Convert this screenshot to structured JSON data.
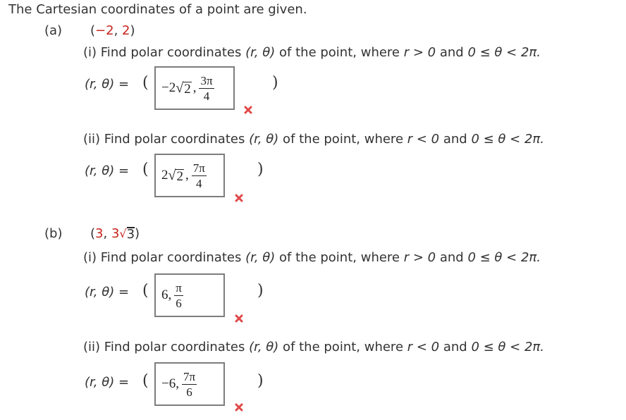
{
  "title": "The Cartesian coordinates of a point are given.",
  "parts": [
    {
      "label": "(a)",
      "point": {
        "open": "(",
        "x": "−2",
        "sep": ", ",
        "y": "2",
        "close": ")"
      },
      "subparts": [
        {
          "prompt_prefix": "(i) Find polar coordinates ",
          "prompt_vars": "(r, θ)",
          "prompt_mid": " of the point, where ",
          "condition_r": "r > 0",
          "prompt_and": " and ",
          "condition_theta": "0 ≤ θ < 2π.",
          "eq_label": "(r, θ) =",
          "open_paren": "(",
          "close_paren": ")",
          "answer": {
            "r_sign": "−",
            "r_coef": "2",
            "r_radicand": "2",
            "sep": ",",
            "theta_num": "3π",
            "theta_den": "4"
          },
          "status": "incorrect",
          "status_icon": "x-mark-icon"
        },
        {
          "prompt_prefix": "(ii) Find polar coordinates ",
          "prompt_vars": "(r, θ)",
          "prompt_mid": " of the point, where ",
          "condition_r": "r < 0",
          "prompt_and": " and ",
          "condition_theta": "0 ≤ θ < 2π.",
          "eq_label": "(r, θ) =",
          "open_paren": "(",
          "close_paren": ")",
          "answer": {
            "r_sign": "",
            "r_coef": "2",
            "r_radicand": "2",
            "sep": ",",
            "theta_num": "7π",
            "theta_den": "4"
          },
          "status": "incorrect",
          "status_icon": "x-mark-icon"
        }
      ]
    },
    {
      "label": "(b)",
      "point": {
        "open": "(",
        "x": "3",
        "sep": ", ",
        "y_coef": "3",
        "y_radicand": "3",
        "close": ")"
      },
      "subparts": [
        {
          "prompt_prefix": "(i) Find polar coordinates ",
          "prompt_vars": "(r, θ)",
          "prompt_mid": " of the point, where ",
          "condition_r": "r > 0",
          "prompt_and": " and ",
          "condition_theta": "0 ≤ θ < 2π.",
          "eq_label": "(r, θ) =",
          "open_paren": "(",
          "close_paren": ")",
          "answer": {
            "r": "6",
            "sep": ",",
            "theta_num": "π",
            "theta_den": "6"
          },
          "status": "incorrect",
          "status_icon": "x-mark-icon"
        },
        {
          "prompt_prefix": "(ii) Find polar coordinates ",
          "prompt_vars": "(r, θ)",
          "prompt_mid": " of the point, where ",
          "condition_r": "r < 0",
          "prompt_and": " and ",
          "condition_theta": "0 ≤ θ < 2π.",
          "eq_label": "(r, θ) =",
          "open_paren": "(",
          "close_paren": ")",
          "answer": {
            "r": "−6",
            "sep": ",",
            "theta_num": "7π",
            "theta_den": "6"
          },
          "status": "incorrect",
          "status_icon": "x-mark-icon"
        }
      ]
    }
  ],
  "colors": {
    "text": "#333333",
    "highlight": "#c8251f",
    "incorrect": "#e04848",
    "box_border": "#7d7d7d"
  }
}
